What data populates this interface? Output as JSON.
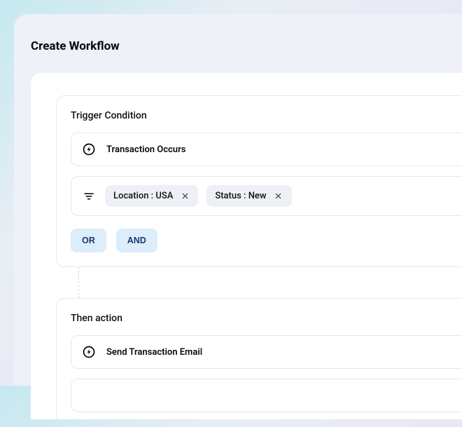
{
  "page": {
    "title": "Create Workflow"
  },
  "trigger": {
    "section_title": "Trigger Condition",
    "event_label": "Transaction Occurs",
    "filters": [
      {
        "label": "Location : USA"
      },
      {
        "label": "Status : New"
      }
    ],
    "logic": {
      "or_label": "OR",
      "and_label": "AND"
    }
  },
  "action": {
    "section_title": "Then action",
    "event_label": "Send Transaction Email"
  }
}
